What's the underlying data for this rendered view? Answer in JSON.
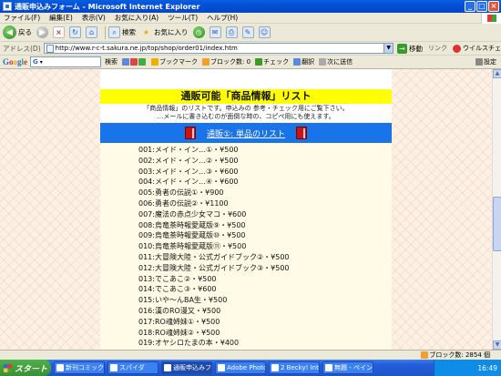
{
  "window": {
    "title": "通販申込みフォーム - Microsoft Internet Explorer",
    "min": "_",
    "max": "□",
    "close": "×"
  },
  "menu": [
    "ファイル(F)",
    "編集(E)",
    "表示(V)",
    "お気に入り(A)",
    "ツール(T)",
    "ヘルプ(H)"
  ],
  "toolbar": {
    "back": "戻る",
    "search": "検索",
    "favorites": "お気に入り"
  },
  "address": {
    "label": "アドレス(D)",
    "url": "http://www.r-c-t.sakura.ne.jp/top/shop/order01/index.htm",
    "go": "移動",
    "links": "リンク",
    "virus": "ウイルスチェ"
  },
  "google": {
    "logo": "Google",
    "search": "検索",
    "bookmark": "ブックマーク",
    "blocked": "ブロック数: 0",
    "check": "チェック",
    "translate": "翻訳",
    "send": "次に送信",
    "settings": "設定"
  },
  "page": {
    "title": "通販可能「商品情報」リスト",
    "intro_1": "「商品情報」のリストです。申込みの 参考・チェック用にご覧下さい。",
    "intro_2": "…メールに書き込むのが面倒な時の、コピペ用にも使えます。",
    "section_link": "通販①: 単品のリスト"
  },
  "products": [
    "001:メイド・イン…①・¥500",
    "002:メイド・イン…②・¥500",
    "003:メイド・イン…③・¥600",
    "004:メイド・イン…④・¥600",
    "005:勇者の伝説①・¥900",
    "006:勇者の伝説②・¥1100",
    "007:魔法の赤点少女マコ・¥600",
    "008:烏竜茶時報愛蔵版⑨・¥500",
    "009:烏竜茶時報愛蔵版⑩・¥500",
    "010:烏竜茶時報愛蔵版⑪・¥500",
    "011:大冒険大陸・公式ガイドブック②・¥500",
    "012:大冒険大陸・公式ガイドブック③・¥500",
    "013:でこあこ②・¥500",
    "014:でこあこ③・¥600",
    "015:いや〜んBA生・¥500",
    "016:漢のRO漫又・¥500",
    "017:RO魂姉妹①・¥500",
    "018:RO魂姉妹②・¥500",
    "019:オヤシロたまの本・¥400"
  ],
  "status": {
    "blocked": "ブロック数: 2854 個"
  },
  "taskbar": {
    "start": "スタート",
    "tasks": [
      "新刊コミック-20...",
      "スパイダ",
      "通販申込みフォ...",
      "Adobe Photos...",
      "2 Becky! Inte...",
      "無題 - ペイント"
    ],
    "active_index": 2,
    "clock": "16:49"
  }
}
